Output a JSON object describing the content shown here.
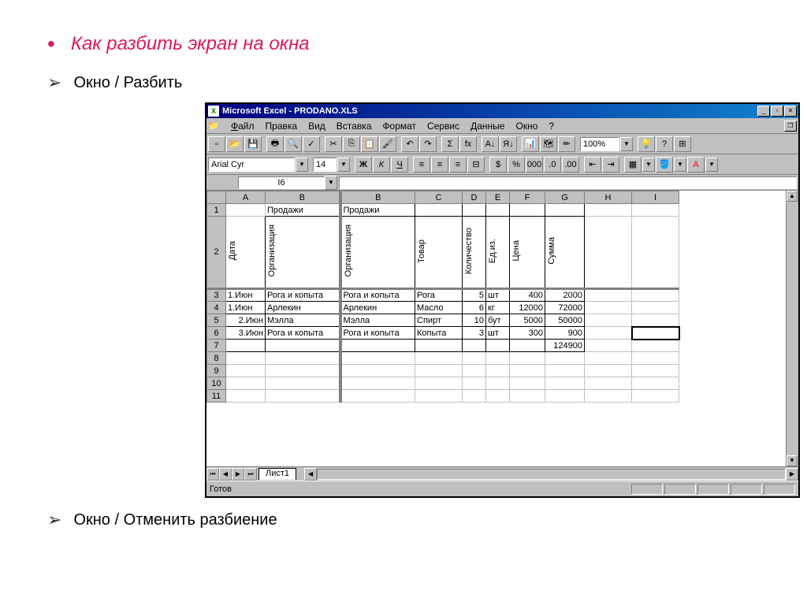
{
  "slide": {
    "title": "Как разбить экран на окна",
    "item1": "Окно / Разбить",
    "item2": "Окно / Отменить разбиение"
  },
  "window": {
    "title": "Microsoft Excel - PRODANO.XLS",
    "icon_letter": "X"
  },
  "menu": {
    "file": "Файл",
    "edit": "Правка",
    "view": "Вид",
    "insert": "Вставка",
    "format": "Формат",
    "tools": "Сервис",
    "data": "Данные",
    "window": "Окно",
    "help": "?"
  },
  "toolbar": {
    "zoom": "100%"
  },
  "format": {
    "font": "Arial Cyr",
    "size": "14"
  },
  "formula": {
    "cell": "I6"
  },
  "cols_left": [
    "A",
    "B"
  ],
  "cols_right": [
    "B",
    "C",
    "D",
    "E",
    "F",
    "G",
    "H",
    "I"
  ],
  "rows": [
    "1",
    "2",
    "3",
    "4",
    "5",
    "6",
    "7",
    "8",
    "9",
    "10",
    "11"
  ],
  "headers1": {
    "b_left": "Продажи",
    "b_right": "Продажи"
  },
  "headers2": {
    "a": "Дата",
    "b_left": "Организация",
    "b_right": "Организация",
    "c": "Товар",
    "d": "Количество",
    "e": "Ед.из.",
    "f": "Цена",
    "g": "Сумма"
  },
  "data_rows": [
    {
      "a": "1.Июн",
      "bl": "Рога и копыта",
      "br": "Рога и копыта",
      "c": "Рога",
      "d": "5",
      "e": "шт",
      "f": "400",
      "g": "2000"
    },
    {
      "a": "1.Июн",
      "bl": "Арлекин",
      "br": "Арлекин",
      "c": "Масло",
      "d": "6",
      "e": "кг",
      "f": "12000",
      "g": "72000"
    },
    {
      "a": "2.Июн",
      "bl": "Мэлла",
      "br": "Мэлла",
      "c": "Спирт",
      "d": "10",
      "e": "бут",
      "f": "5000",
      "g": "50000"
    },
    {
      "a": "3.Июн",
      "bl": "Рога и копыта",
      "br": "Рога и копыта",
      "c": "Копыта",
      "d": "3",
      "e": "шт",
      "f": "300",
      "g": "900"
    }
  ],
  "total": {
    "g": "124900"
  },
  "tabs": {
    "sheet1": "Лист1"
  },
  "status": {
    "ready": "Готов"
  }
}
